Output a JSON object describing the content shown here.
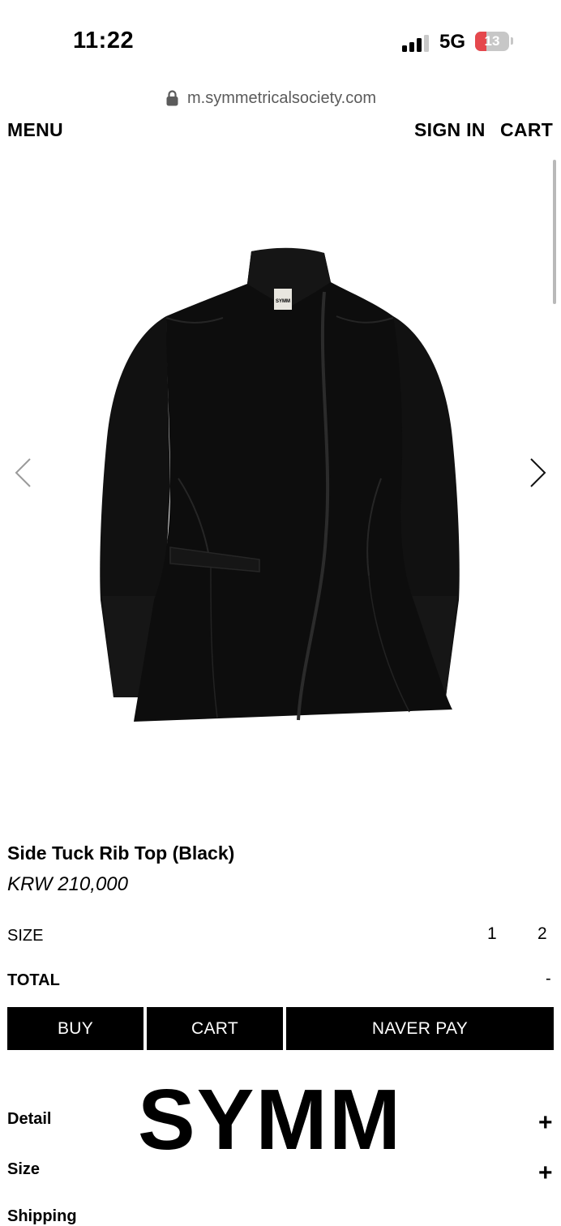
{
  "status_bar": {
    "time": "11:22",
    "network": "5G",
    "battery": "13"
  },
  "browser": {
    "url": "m.symmetricalsociety.com"
  },
  "header": {
    "menu_label": "MENU",
    "sign_in_label": "SIGN IN",
    "cart_label": "CART"
  },
  "product": {
    "name": "Side Tuck Rib Top (Black)",
    "price": "KRW 210,000",
    "size_label": "SIZE",
    "sizes": [
      "1",
      "2"
    ],
    "total_label": "TOTAL",
    "total_value": "-",
    "image_label": "SYMM"
  },
  "actions": {
    "buy_label": "BUY",
    "cart_label": "CART",
    "naver_pay_label": "NAVER PAY"
  },
  "info": {
    "logo_text": "SYMM",
    "sections": [
      {
        "label": "Detail",
        "toggle": "+"
      },
      {
        "label": "Size",
        "toggle": "+"
      },
      {
        "label": "Shipping",
        "toggle": ""
      }
    ]
  },
  "colors": {
    "text": "#000000",
    "button_bg": "#000000",
    "button_text": "#ffffff",
    "url_text": "#5b5b5b",
    "battery_low": "#e5484d"
  },
  "icons": {
    "lock": "lock-icon",
    "signal": "cellular-signal-icon",
    "battery": "battery-icon",
    "prev": "chevron-left-icon",
    "next": "chevron-right-icon"
  }
}
